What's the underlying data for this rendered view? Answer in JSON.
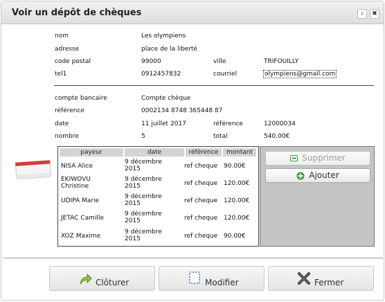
{
  "window": {
    "title": "Voir un dépôt de chèques"
  },
  "titlebar": {
    "restore_glyph": "⌽",
    "close_glyph": "✖"
  },
  "info": {
    "nom_label": "nom",
    "nom_value": "Les olympiens",
    "adresse_label": "adresse",
    "adresse_value": "place de la liberté",
    "cp_label": "code postal",
    "cp_value": "99000",
    "ville_label": "ville",
    "ville_value": "TRIFOUILLY",
    "tel_label": "tel1",
    "tel_value": "0912457832",
    "courriel_label": "courriel",
    "courriel_value": "olympiens@gmail.com"
  },
  "deposit": {
    "compte_label": "compte bancaire",
    "compte_value": "Compte chèque",
    "ref_label": "référence",
    "ref_value": "0002134 8748 365448 87",
    "date_label": "date",
    "date_value": "11 juillet 2017",
    "ref2_label": "référence",
    "ref2_value": "12000034",
    "nombre_label": "nombre",
    "nombre_value": "5",
    "total_label": "total",
    "total_value": "540.00€"
  },
  "table": {
    "headers": [
      "payeur",
      "date",
      "référence",
      "montant"
    ],
    "rows": [
      {
        "payeur": "NISA Alice",
        "date": "9 décembre 2015",
        "reference": "ref cheque",
        "montant": "90.00€"
      },
      {
        "payeur": "EKIWOVU Christine",
        "date": "9 décembre 2015",
        "reference": "ref cheque",
        "montant": "120.00€"
      },
      {
        "payeur": "UDIPA Marie",
        "date": "9 décembre 2015",
        "reference": "ref cheque",
        "montant": "120.00€"
      },
      {
        "payeur": "JETAC Camille",
        "date": "9 décembre 2015",
        "reference": "ref cheque",
        "montant": "120.00€"
      },
      {
        "payeur": "XOZ Maxime",
        "date": "9 décembre 2015",
        "reference": "ref cheque",
        "montant": "90.00€"
      }
    ]
  },
  "side_buttons": {
    "supprimer": "Supprimer",
    "ajouter": "Ajouter"
  },
  "footer": {
    "cloturer": "Clôturer",
    "modifier": "Modifier",
    "fermer": "Fermer"
  },
  "icons": {
    "card": "credit-card-icon",
    "minus": "minus-icon",
    "add": "plus-circle-icon",
    "cloturer": "curved-arrow-icon",
    "modifier": "edit-frame-icon",
    "fermer": "close-x-icon"
  },
  "colors": {
    "card_red": "#d83a3a",
    "add_green": "#3a9a3a",
    "panel_gray": "#c4c4c4"
  }
}
